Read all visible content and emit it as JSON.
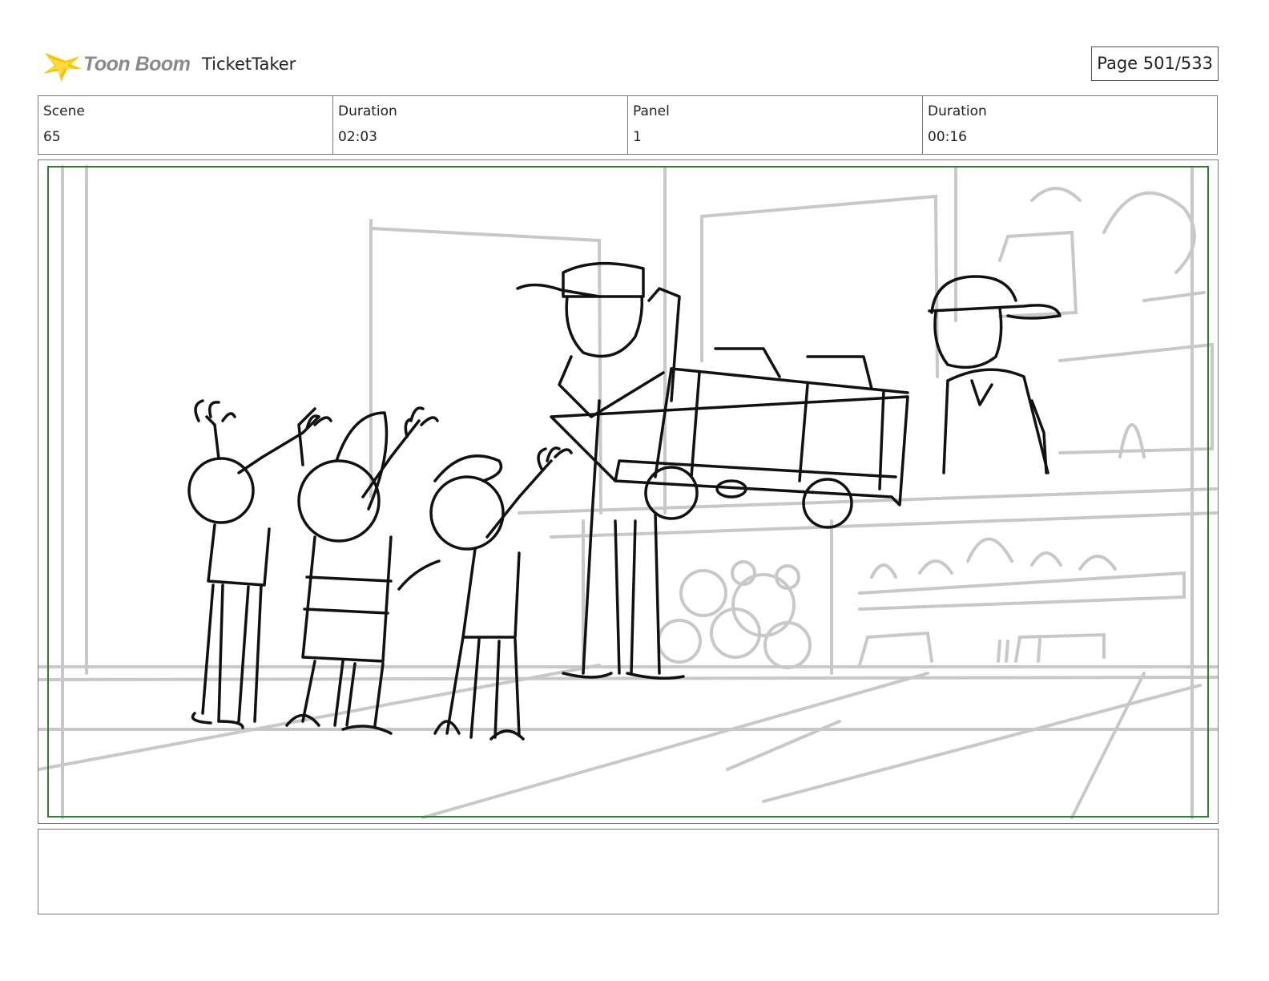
{
  "header": {
    "brand": "Toon Boom",
    "project": "TicketTaker",
    "page": "Page 501/533",
    "logo_icon": "starburst-logo-icon",
    "brand_color": "#f5c400"
  },
  "info": {
    "scene_label": "Scene",
    "scene_value": "65",
    "scene_duration_label": "Duration",
    "scene_duration_value": "02:03",
    "panel_label": "Panel",
    "panel_value": "1",
    "panel_duration_label": "Duration",
    "panel_duration_value": "00:16"
  },
  "panel": {
    "safe_frame_color": "#2e7d32",
    "line_color": "#111111",
    "background_line_color": "#c8c8c8"
  },
  "notes": {
    "text": ""
  }
}
